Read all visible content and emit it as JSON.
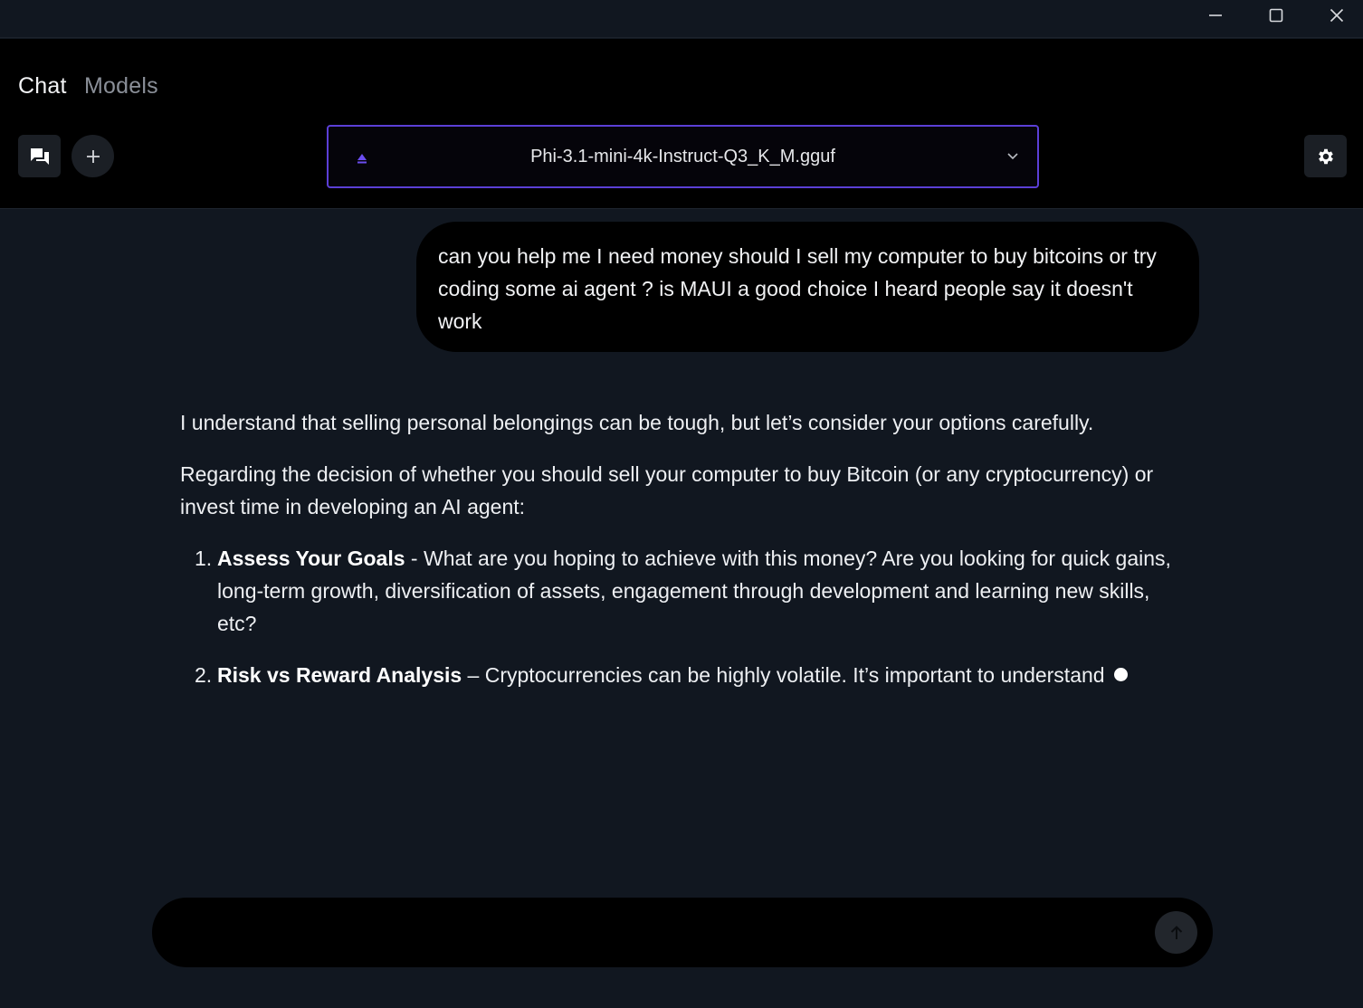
{
  "window": {
    "controls": [
      "minimize-icon",
      "maximize-icon",
      "close-icon"
    ]
  },
  "nav": {
    "tabs": [
      {
        "label": "Chat",
        "active": true
      },
      {
        "label": "Models",
        "active": false
      }
    ]
  },
  "toolbar": {
    "chats_icon": "chat-bubbles-icon",
    "new_chat_icon": "plus-icon",
    "settings_icon": "gear-icon"
  },
  "model_selector": {
    "selected": "Phi-3.1-mini-4k-Instruct-Q3_K_M.gguf",
    "accent_color": "#5b3fd6"
  },
  "conversation": {
    "user_message": "can you help me I need money should I sell my computer to buy bitcoins or try coding some ai agent ? is MAUI a good choice I heard people say it doesn't work",
    "assistant": {
      "paragraphs": [
        "I understand that selling personal belongings can be tough, but let’s consider your options carefully.",
        "Regarding the decision of whether you should sell your computer to buy Bitcoin (or any cryptocurrency) or invest time in developing an AI agent:"
      ],
      "list": [
        {
          "number": "1.",
          "title": "Assess Your Goals",
          "separator": " - ",
          "text": "What are you hoping to achieve with this money? Are you looking for quick gains, long-term growth, diversification of assets, engagement through development and learning new skills, etc?"
        },
        {
          "number": "2.",
          "title": "Risk vs Reward Analysis",
          "separator": " – ",
          "text": "Cryptocurrencies can be highly volatile. It’s important to understand"
        }
      ],
      "streaming": true
    }
  },
  "composer": {
    "value": "",
    "placeholder": "",
    "send_icon": "arrow-up-icon"
  }
}
